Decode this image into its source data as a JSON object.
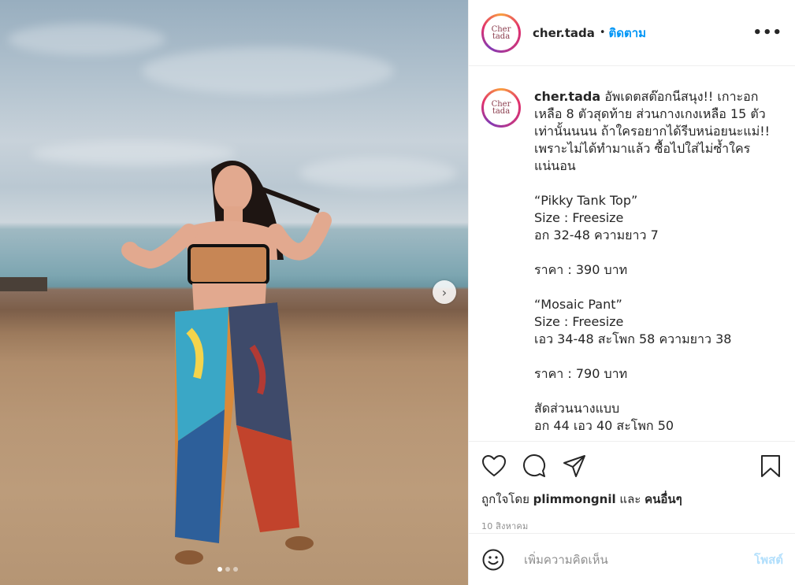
{
  "post": {
    "username": "cher.tada",
    "follow_label": "ติดตาม",
    "separator": "•",
    "avatar_text": "Cher tada",
    "more_icon": "more-options-icon",
    "image_icon_next": "chevron-right-icon",
    "carousel": {
      "count": 3,
      "active": 1
    }
  },
  "caption": {
    "username": "cher.tada",
    "text": " อัพเดตสต๊อกนีสนุง!! เกาะอกเหลือ 8 ตัวสุดท้าย ส่วนกางเกงเหลือ 15 ตัวเท่านั้นนนน ถ้าใครอยากได้รีบหน่อยนะแม่!! เพราะไม่ได้ทำมาแล้ว ซื้อไปใส่ไม่ซ้ำใครแน่นอน\n\n“Pikky Tank Top”\nSize : Freesize\nอก 32-48 ความยาว 7\n\nราคา : 390 บาท\n\n“Mosaic Pant”\nSize : Freesize\nเอว 34-48 สะโพก 58 ความยาว 38\n\nราคา : 790 บาท\n\nสัดส่วนนางแบบ\nอก 44 เอว 40 สะโพก 50"
  },
  "actions": {
    "like_icon": "heart-icon",
    "comment_icon": "comment-icon",
    "share_icon": "share-icon",
    "save_icon": "bookmark-icon"
  },
  "likes": {
    "prefix": "ถูกใจโดย",
    "user": "plimmongnil",
    "joiner": "และ",
    "others": "คนอื่นๆ"
  },
  "date": "10 สิงหาคม",
  "comment": {
    "emoji_icon": "emoji-icon",
    "placeholder": "เพิ่มความคิดเห็น",
    "post_label": "โพสต์"
  }
}
